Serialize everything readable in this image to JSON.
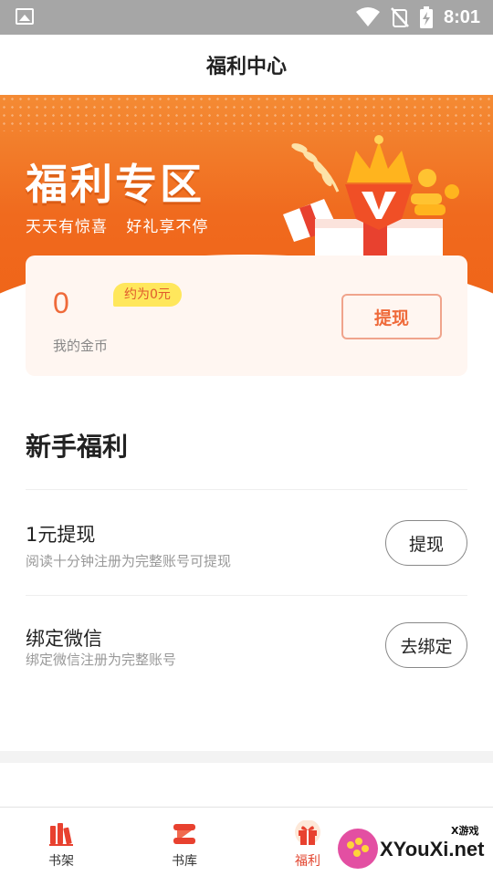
{
  "status_bar": {
    "time": "8:01",
    "icons": [
      "image-icon",
      "wifi-icon",
      "no-signal-icon",
      "battery-charging-icon"
    ]
  },
  "header": {
    "title": "福利中心"
  },
  "banner": {
    "title": "福利专区",
    "subtitle": "天天有惊喜 好礼享不停",
    "colors": {
      "gradient_top": "#f48b34",
      "gradient_bottom": "#ef6418"
    }
  },
  "coin_card": {
    "amount": "0",
    "badge": "约为0元",
    "label": "我的金币",
    "withdraw_label": "提现",
    "accent": "#ef6a3a"
  },
  "newbie": {
    "title": "新手福利",
    "tasks": [
      {
        "title": "1元提现",
        "desc": "阅读十分钟注册为完整账号可提现",
        "button": "提现"
      },
      {
        "title": "绑定微信",
        "desc": "绑定微信注册为完整账号",
        "button": "去绑定"
      }
    ]
  },
  "bottom_nav": {
    "items": [
      {
        "label": "书架",
        "icon": "bookshelf-icon",
        "active": false
      },
      {
        "label": "书库",
        "icon": "library-icon",
        "active": false
      },
      {
        "label": "福利",
        "icon": "gift-icon",
        "active": true
      }
    ],
    "active_color": "#e2452f"
  },
  "watermark": {
    "small": "X游戏",
    "big": "XYouXi.net"
  }
}
